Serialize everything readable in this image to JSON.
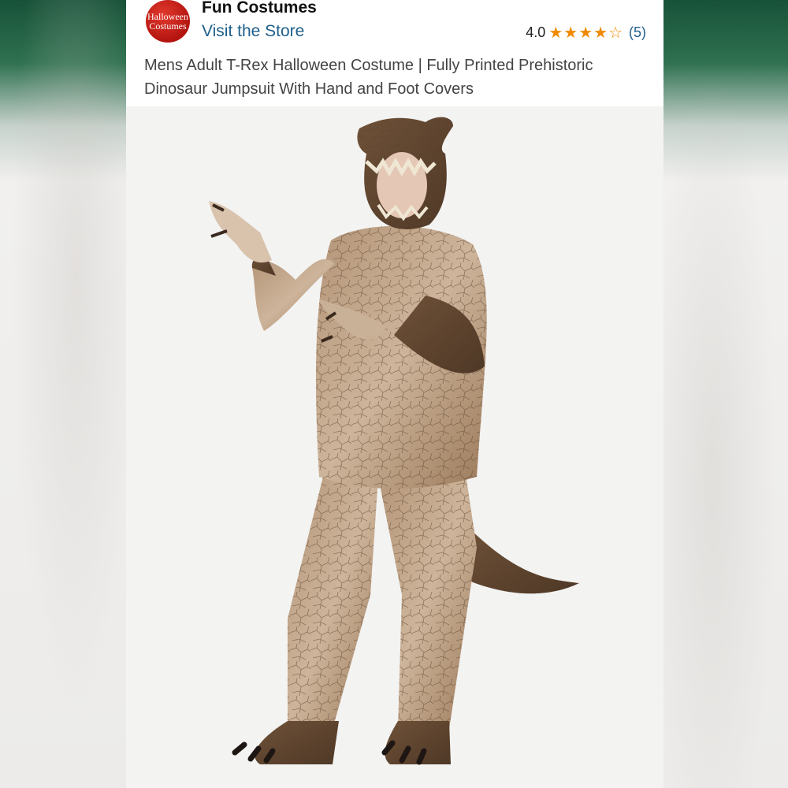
{
  "store": {
    "logo_text_line1": "Halloween",
    "logo_text_line2": "Costumes",
    "name": "Fun Costumes",
    "visit_label": "Visit the Store"
  },
  "rating": {
    "value": "4.0",
    "stars_filled": 4,
    "stars_total": 5,
    "review_count": "(5)"
  },
  "product": {
    "title": "Mens Adult T-Rex Halloween Costume | Fully Printed Prehistoric Dinosaur Jumpsuit With Hand and Foot Covers"
  },
  "colors": {
    "link": "#1f5f8b",
    "star": "#f08a00",
    "logo": "#c41a13"
  },
  "icons": [
    "store-logo",
    "star-icon",
    "star-empty-icon"
  ]
}
